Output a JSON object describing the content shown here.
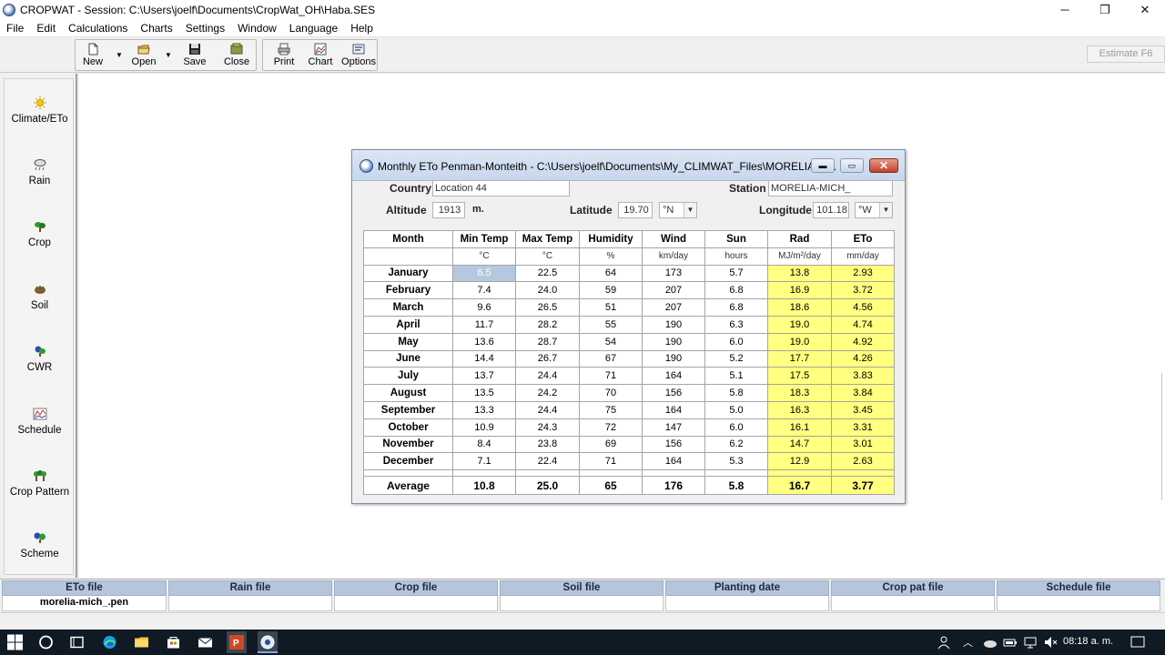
{
  "window": {
    "title": "CROPWAT - Session: C:\\Users\\joelf\\Documents\\CropWat_OH\\Haba.SES",
    "controls": [
      "─",
      "❐",
      "✕"
    ]
  },
  "menu": [
    "File",
    "Edit",
    "Calculations",
    "Charts",
    "Settings",
    "Window",
    "Language",
    "Help"
  ],
  "toolbar": {
    "new": "New",
    "open": "Open",
    "save": "Save",
    "close": "Close",
    "print": "Print",
    "chart": "Chart",
    "options": "Options",
    "estimate": "Estimate  F6"
  },
  "sidebar": {
    "items": [
      {
        "label": "Climate/ETo",
        "icon": "sun-icon"
      },
      {
        "label": "Rain",
        "icon": "cloud-rain-icon"
      },
      {
        "label": "Crop",
        "icon": "plant-icon"
      },
      {
        "label": "Soil",
        "icon": "soil-icon"
      },
      {
        "label": "CWR",
        "icon": "cwr-icon"
      },
      {
        "label": "Schedule",
        "icon": "schedule-icon"
      },
      {
        "label": "Crop Pattern",
        "icon": "crop-pattern-icon"
      },
      {
        "label": "Scheme",
        "icon": "scheme-icon"
      }
    ]
  },
  "child_window": {
    "title": "Monthly ETo Penman-Monteith - C:\\Users\\joelf\\Documents\\My_CLIMWAT_Files\\MORELIA-M...",
    "country_label": "Country",
    "country_value": "Location 44",
    "station_label": "Station",
    "station_value": "MORELIA-MICH_",
    "altitude_label": "Altitude",
    "altitude_value": "1913",
    "altitude_unit": "m.",
    "latitude_label": "Latitude",
    "latitude_value": "19.70",
    "latitude_dir": "°N",
    "longitude_label": "Longitude",
    "longitude_value": "101.18",
    "longitude_dir": "°W"
  },
  "table": {
    "headers": [
      "Month",
      "Min Temp",
      "Max Temp",
      "Humidity",
      "Wind",
      "Sun",
      "Rad",
      "ETo"
    ],
    "units": [
      "",
      "°C",
      "°C",
      "%",
      "km/day",
      "hours",
      "MJ/m²/day",
      "mm/day"
    ],
    "rows": [
      [
        "January",
        "6.5",
        "22.5",
        "64",
        "173",
        "5.7",
        "13.8",
        "2.93"
      ],
      [
        "February",
        "7.4",
        "24.0",
        "59",
        "207",
        "6.8",
        "16.9",
        "3.72"
      ],
      [
        "March",
        "9.6",
        "26.5",
        "51",
        "207",
        "6.8",
        "18.6",
        "4.56"
      ],
      [
        "April",
        "11.7",
        "28.2",
        "55",
        "190",
        "6.3",
        "19.0",
        "4.74"
      ],
      [
        "May",
        "13.6",
        "28.7",
        "54",
        "190",
        "6.0",
        "19.0",
        "4.92"
      ],
      [
        "June",
        "14.4",
        "26.7",
        "67",
        "190",
        "5.2",
        "17.7",
        "4.26"
      ],
      [
        "July",
        "13.7",
        "24.4",
        "71",
        "164",
        "5.1",
        "17.5",
        "3.83"
      ],
      [
        "August",
        "13.5",
        "24.2",
        "70",
        "156",
        "5.8",
        "18.3",
        "3.84"
      ],
      [
        "September",
        "13.3",
        "24.4",
        "75",
        "164",
        "5.0",
        "16.3",
        "3.45"
      ],
      [
        "October",
        "10.9",
        "24.3",
        "72",
        "147",
        "6.0",
        "16.1",
        "3.31"
      ],
      [
        "November",
        "8.4",
        "23.8",
        "69",
        "156",
        "6.2",
        "14.7",
        "3.01"
      ],
      [
        "December",
        "7.1",
        "22.4",
        "71",
        "164",
        "5.3",
        "12.9",
        "2.63"
      ]
    ],
    "average": [
      "Average",
      "10.8",
      "25.0",
      "65",
      "176",
      "5.8",
      "16.7",
      "3.77"
    ]
  },
  "files": [
    {
      "label": "ETo file",
      "value": "morelia-mich_.pen"
    },
    {
      "label": "Rain file",
      "value": ""
    },
    {
      "label": "Crop file",
      "value": ""
    },
    {
      "label": "Soil file",
      "value": ""
    },
    {
      "label": "Planting date",
      "value": ""
    },
    {
      "label": "Crop pat file",
      "value": ""
    },
    {
      "label": "Schedule file",
      "value": ""
    }
  ],
  "taskbar": {
    "clock": "08:18 a. m."
  },
  "colors": {
    "highlight_yellow": "#ffff80",
    "file_header": "#b4c5dc",
    "selected_cell": "#b5c8de"
  }
}
